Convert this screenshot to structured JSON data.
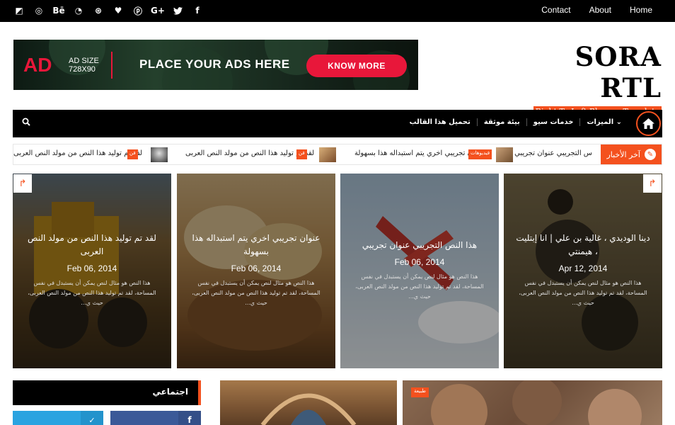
{
  "topbar": {
    "social_icons": [
      {
        "name": "delicious-icon",
        "glyph": "◩"
      },
      {
        "name": "instagram-icon",
        "glyph": "◎"
      },
      {
        "name": "behance-icon",
        "glyph": "Bē"
      },
      {
        "name": "rss-icon",
        "glyph": "◔"
      },
      {
        "name": "dribbble-icon",
        "glyph": "⊛"
      },
      {
        "name": "heart-icon",
        "glyph": "♥"
      },
      {
        "name": "pinterest-icon",
        "glyph": "ⓟ"
      },
      {
        "name": "google-plus-icon",
        "glyph": "G+"
      },
      {
        "name": "twitter-icon",
        "glyph": "🐦"
      },
      {
        "name": "facebook-icon",
        "glyph": "f"
      }
    ],
    "links": [
      "Contact",
      "About",
      "Home"
    ]
  },
  "ad": {
    "big": "AD",
    "size_line1": "AD SIZE",
    "size_line2": "728X90",
    "main": "PLACE YOUR ADS HERE",
    "button": "KNOW MORE"
  },
  "logo": {
    "title": "SORA RTL",
    "tagline": "Right To Left Blogger Template"
  },
  "nav": {
    "items": [
      "الميزات ⌄",
      "خدمات سيو",
      "بيئة موثقة",
      "تحميل هذا القالب"
    ]
  },
  "ticker": {
    "label": "آخر الأخبار",
    "items": [
      {
        "text": "س التجريبي عنوان تجريبي",
        "badge": ""
      },
      {
        "text": "عنوان تجريبي اخري يتم استبداله هذا بسهولة",
        "badge": "فيديوهات"
      },
      {
        "text": "لقد تم توليد هذا النص من مولد النص العربى",
        "badge": "فن"
      },
      {
        "text": "لقد تم توليد هذا النص من مولد النص العربى",
        "badge": "فن"
      }
    ]
  },
  "cards": [
    {
      "title": "لقد تم توليد هذا النص من مولد النص العربى",
      "date": "Feb 06, 2014",
      "excerpt": "هذا النص هو مثال لنص يمكن أن يستبدل في نفس المساحة، لقد تم توليد هذا النص من مولد النص العربى، حيث ي..."
    },
    {
      "title": "عنوان تجريبي اخري يتم استبداله هذا بسهولة",
      "date": "Feb 06, 2014",
      "excerpt": "هذا النص هو مثال لنص يمكن أن يستبدل في نفس المساحة، لقد تم توليد هذا النص من مولد النص العربى، حيث ي..."
    },
    {
      "title": "هذا النص التجريبي عنوان تجريبي",
      "date": "Feb 06, 2014",
      "excerpt": "هذا النص هو مثال لنص يمكن أن يستبدل في نفس المساحة، لقد تم توليد هذا النص من مولد النص العربى، حيث ي..."
    },
    {
      "title": "دينا الوديدي ، غالية بن علي | انا إبتليت ، هيمنتي",
      "date": "Apr 12, 2014",
      "excerpt": "هذا النص هو مثال لنص يمكن أن يستبدل في نفس المساحة، لقد تم توليد هذا النص من مولد النص العربى، حيث ي..."
    }
  ],
  "widget": {
    "title": "اجتماعي"
  },
  "posts": [
    {
      "tag": ""
    },
    {
      "tag": "طبيعة"
    }
  ],
  "colors": {
    "accent": "#f4511e",
    "dark": "#000000",
    "ad_red": "#e8173a"
  }
}
